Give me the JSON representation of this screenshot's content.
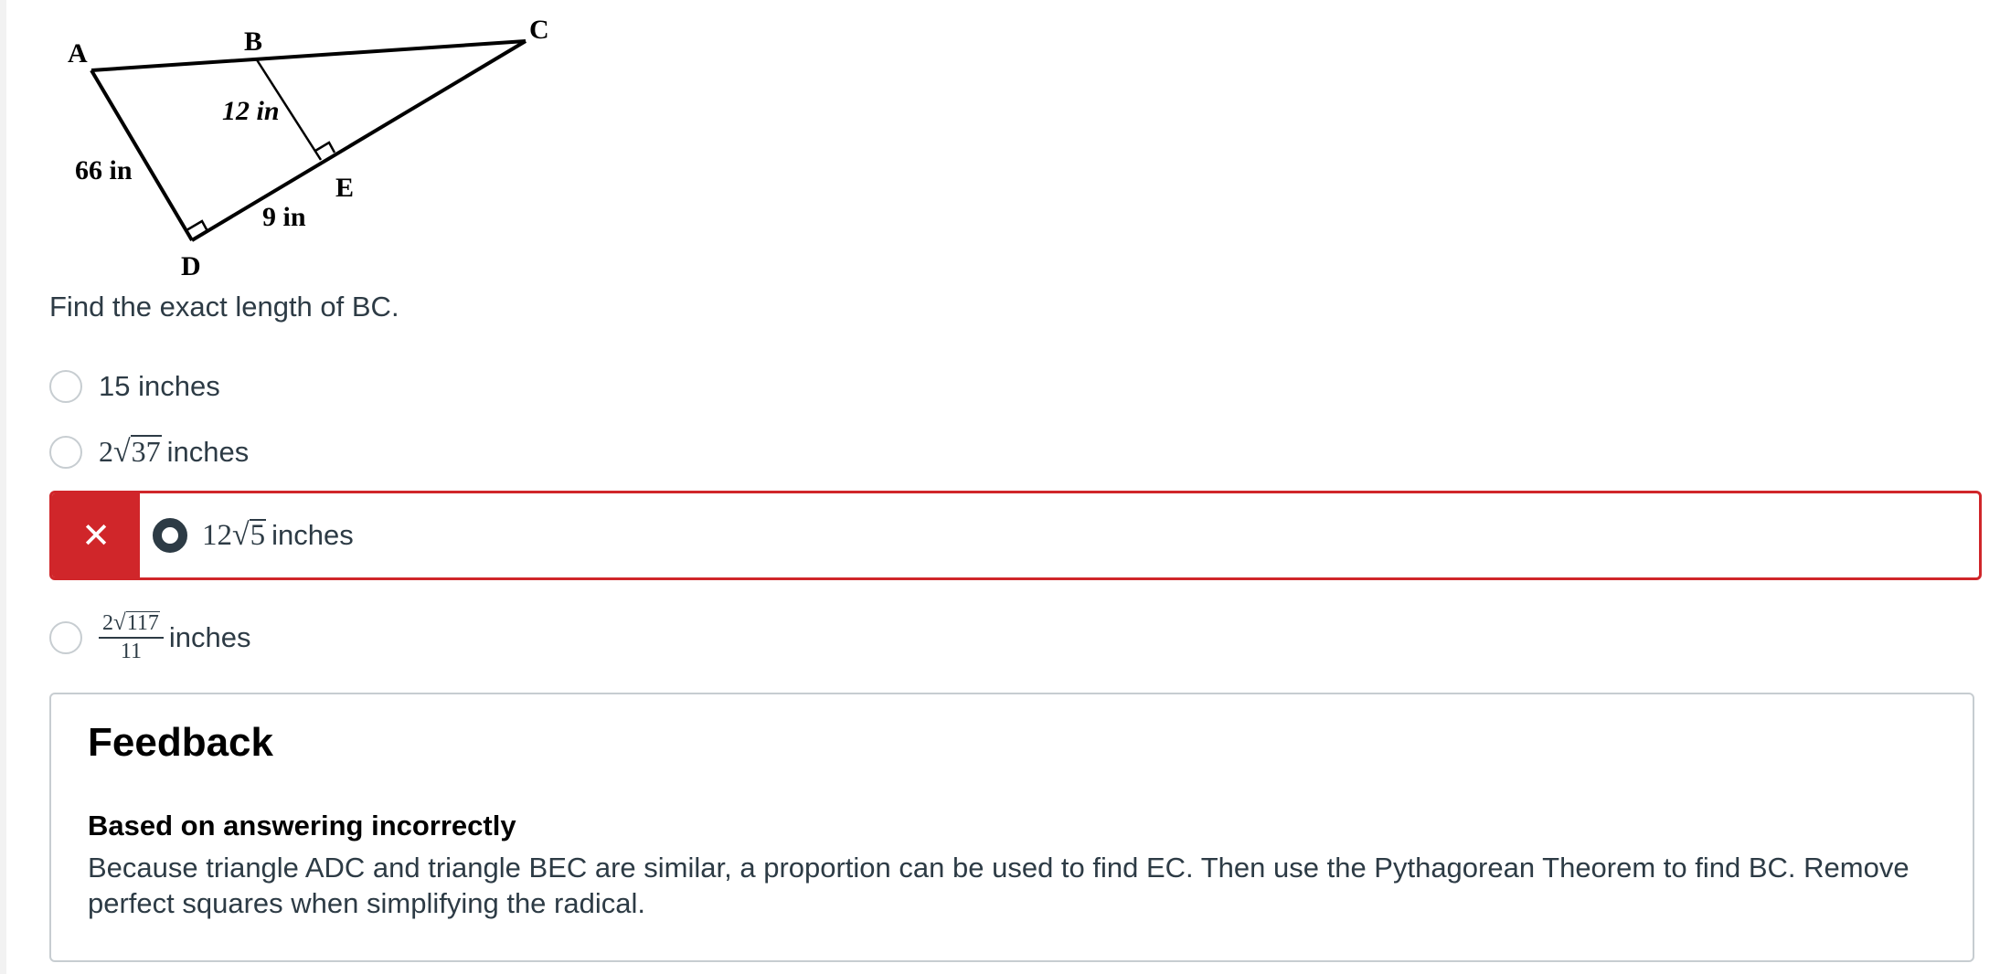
{
  "figure": {
    "labels": {
      "A": "A",
      "B": "B",
      "C": "C",
      "D": "D",
      "E": "E",
      "ad_length": "66 in",
      "be_length": "12 in",
      "de_length": "9 in"
    }
  },
  "question": {
    "text": "Find the exact length of BC."
  },
  "options": [
    {
      "text": "15 inches"
    },
    {
      "coef": "2",
      "radicand": "37",
      "unit": "inches"
    },
    {
      "coef": "12",
      "radicand": "5",
      "unit": "inches",
      "selected": true,
      "status": "incorrect"
    },
    {
      "num_coef": "2",
      "num_radicand": "117",
      "denominator": "11",
      "unit": "inches"
    }
  ],
  "status_icon": "close-icon",
  "feedback": {
    "title": "Feedback",
    "subtitle": "Based on answering incorrectly",
    "body": "Because triangle ADC and triangle BEC are similar, a proportion can be used to find EC.  Then use the Pythagorean Theorem to find BC. Remove perfect squares when simplifying the radical."
  },
  "colors": {
    "error_red": "#d0262a",
    "text": "#2d3b45",
    "border_gray": "#c7cdd1"
  }
}
